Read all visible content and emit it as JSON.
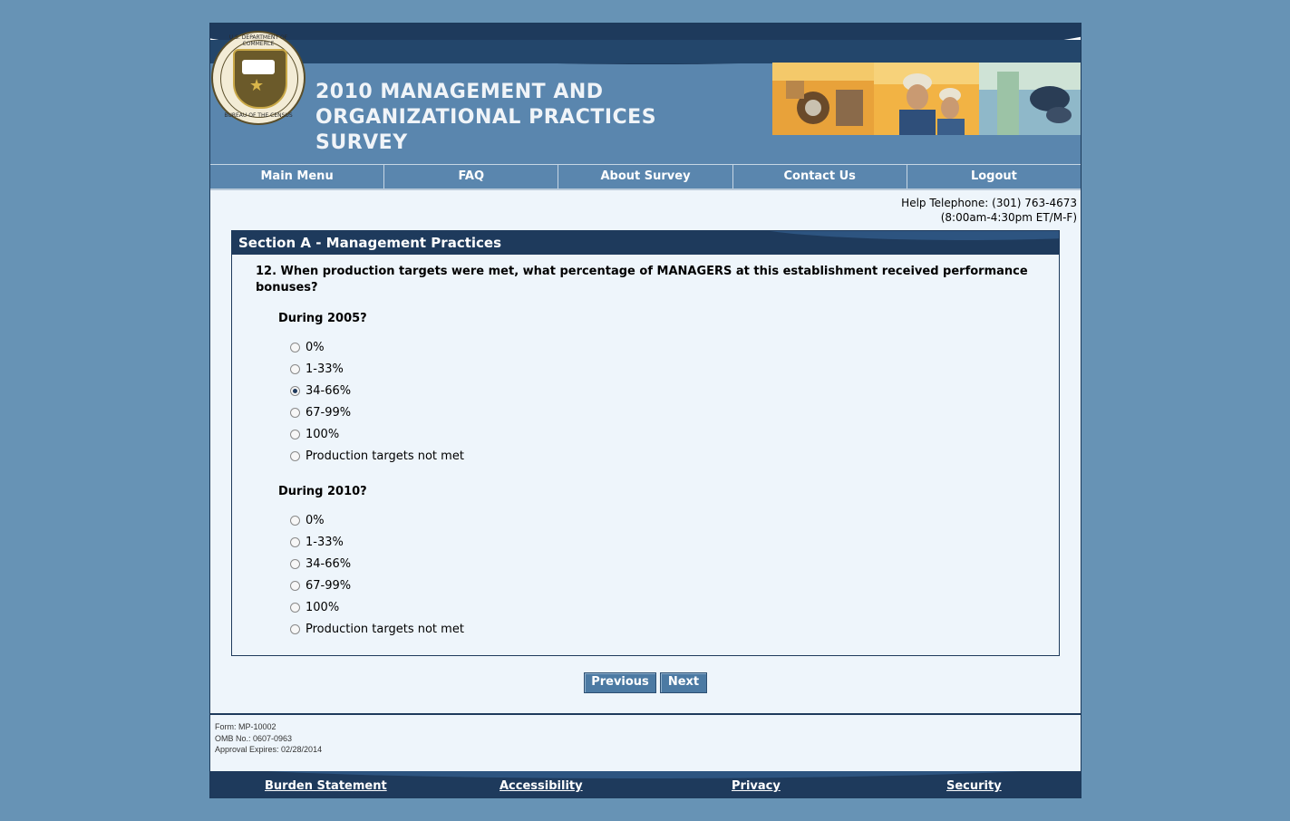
{
  "header": {
    "seal_text_top": "U.S. DEPARTMENT OF COMMERCE",
    "seal_text_bottom": "BUREAU OF THE CENSUS",
    "title_line1": "2010 MANAGEMENT AND",
    "title_line2": "ORGANIZATIONAL PRACTICES",
    "title_line3": "SURVEY"
  },
  "nav": [
    "Main Menu",
    "FAQ",
    "About Survey",
    "Contact Us",
    "Logout"
  ],
  "help": {
    "telephone": "Help Telephone: (301) 763-4673",
    "hours": "(8:00am-4:30pm ET/M-F)"
  },
  "section": {
    "title": "Section A - Management Practices",
    "question": "12. When production targets were met, what percentage of MANAGERS at this establishment received performance bonuses?",
    "groups": [
      {
        "label": "During 2005?",
        "selected": "34-66%",
        "options": [
          "0%",
          "1-33%",
          "34-66%",
          "67-99%",
          "100%",
          "Production targets not met"
        ]
      },
      {
        "label": "During 2010?",
        "selected": "",
        "options": [
          "0%",
          "1-33%",
          "34-66%",
          "67-99%",
          "100%",
          "Production targets not met"
        ]
      }
    ]
  },
  "buttons": {
    "previous": "Previous",
    "next": "Next"
  },
  "form_info": {
    "form": "Form: MP-10002",
    "omb": "OMB No.: 0607-0963",
    "approval": "Approval Expires: 02/28/2014"
  },
  "footer": [
    "Burden Statement",
    "Accessibility",
    "Privacy",
    "Security"
  ],
  "colors": {
    "page_bg": "#6793b5",
    "dark_navy": "#1e3a5c",
    "header_blue": "#5a86ae",
    "content_bg": "#eef5fb",
    "button_blue": "#4c7aa3"
  }
}
